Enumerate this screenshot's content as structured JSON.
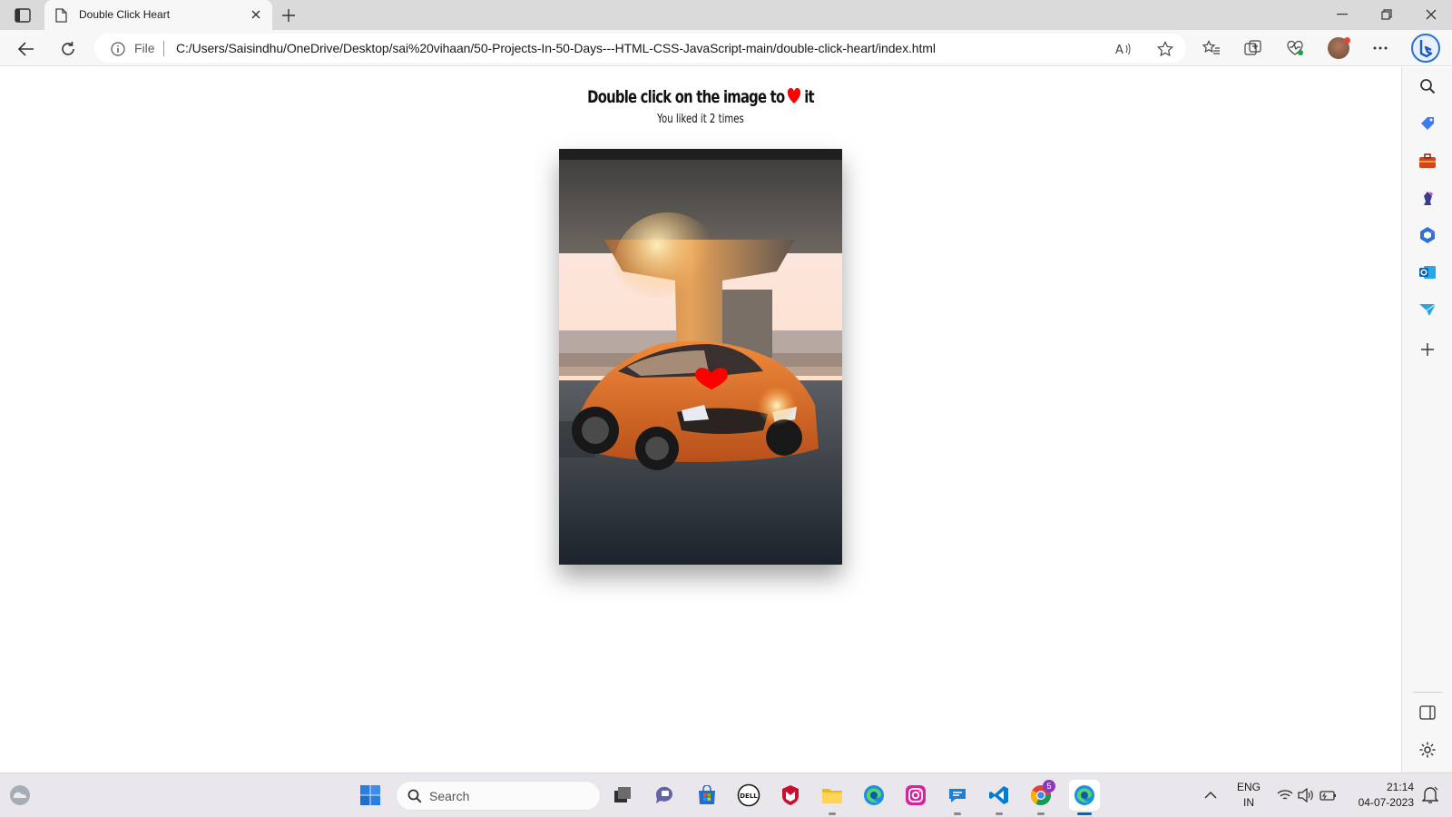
{
  "browser": {
    "tab_title": "Double Click Heart",
    "address": {
      "scheme_label": "File",
      "url": "C:/Users/Saisindhu/OneDrive/Desktop/sai%20vihaan/50-Projects-In-50-Days---HTML-CSS-JavaScript-main/double-click-heart/index.html"
    }
  },
  "page": {
    "title_before": "Double click on the image to",
    "title_after": "it",
    "counter_prefix": "You liked it",
    "like_count": 2,
    "counter_suffix": "times",
    "heart_color": "#ff0000"
  },
  "taskbar": {
    "search_placeholder": "Search",
    "chrome_badge": "5",
    "language": "ENG",
    "region": "IN",
    "time": "21:14",
    "date": "04-07-2023"
  },
  "colors": {
    "accent": "#0067c0",
    "heart": "#ff0000"
  }
}
